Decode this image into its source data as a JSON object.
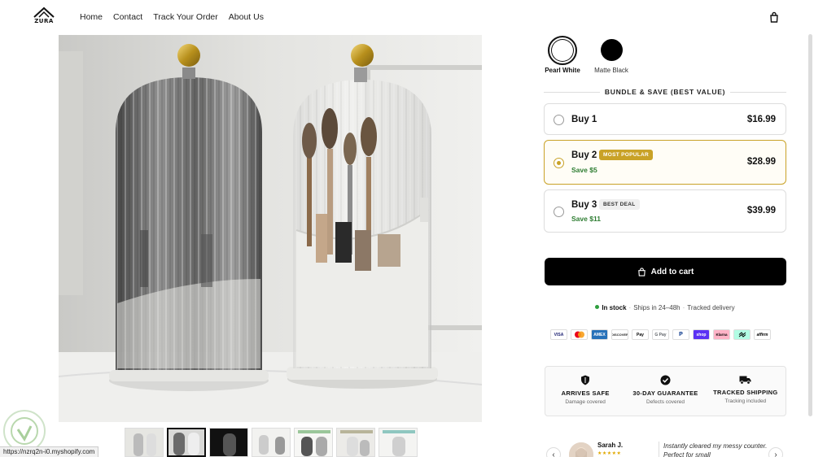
{
  "header": {
    "logo_text": "ZURA",
    "nav": [
      "Home",
      "Contact",
      "Track Your Order",
      "About Us"
    ]
  },
  "gallery": {
    "thumbnail_count": 7,
    "active_thumbnail": 2
  },
  "swatches": [
    {
      "label": "Pearl White",
      "selected": true
    },
    {
      "label": "Matte Black",
      "selected": false
    }
  ],
  "bundle": {
    "heading": "BUNDLE & SAVE (BEST VALUE)",
    "options": [
      {
        "title": "Buy 1",
        "badge": "",
        "save": "",
        "price": "$16.99",
        "selected": false
      },
      {
        "title": "Buy 2",
        "badge": "MOST POPULAR",
        "save": "Save $5",
        "price": "$28.99",
        "selected": true
      },
      {
        "title": "Buy 3",
        "badge": "BEST DEAL",
        "save": "Save $11",
        "price": "$39.99",
        "selected": false
      }
    ]
  },
  "cart": {
    "add_label": "Add to cart"
  },
  "stock": {
    "status": "In stock",
    "ships": "Ships in 24–48h",
    "tracked": "Tracked delivery"
  },
  "payments": [
    "VISA",
    "Mastercard",
    "AMEX",
    "DISCOVER",
    "Apple Pay",
    "G Pay",
    "PayPal",
    "shop",
    "Klarna",
    "Afterpay",
    "affirm"
  ],
  "payment_labels": [
    "VISA",
    "",
    "AMEX",
    "DISCOVER",
    "Pay",
    "G Pay",
    "P",
    "shop",
    "Klarna",
    "",
    "affirm"
  ],
  "guarantees": [
    {
      "title": "ARRIVES SAFE",
      "sub": "Damage covered",
      "icon": "shield-icon"
    },
    {
      "title": "30-DAY GUARANTEE",
      "sub": "Defects covered",
      "icon": "check-badge-icon"
    },
    {
      "title": "TRACKED SHIPPING",
      "sub": "Tracking included",
      "icon": "truck-icon"
    }
  ],
  "review": {
    "name": "Sarah J.",
    "stars": "★★★★★",
    "quote": "Instantly cleared my messy counter. Perfect for small"
  },
  "status_bar": {
    "url": "https://nzrq2n-i0.myshopify.com"
  },
  "colors": {
    "accent_gold": "#c9a227",
    "in_stock_green": "#2e9e3e",
    "save_green": "#2e7d32"
  }
}
